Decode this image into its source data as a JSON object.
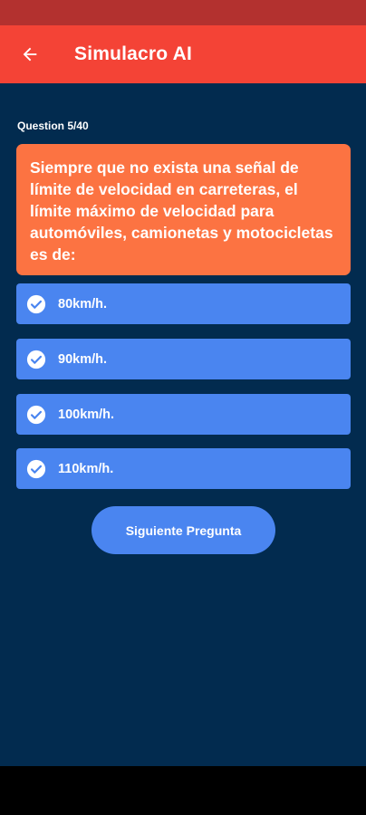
{
  "app_bar": {
    "title": "Simulacro AI",
    "back_icon": "arrow-left-icon"
  },
  "quiz": {
    "counter": "Question 5/40",
    "question": "Siempre que no exista una señal de límite de velocidad en carreteras, el límite máximo de velocidad para automóviles, camionetas y motocicletas es de:",
    "options": [
      {
        "label": "80km/h.",
        "icon": "check-circle-icon"
      },
      {
        "label": "90km/h.",
        "icon": "check-circle-icon"
      },
      {
        "label": "100km/h.",
        "icon": "check-circle-icon"
      },
      {
        "label": "110km/h.",
        "icon": "check-circle-icon"
      }
    ],
    "next_button": "Siguiente Pregunta"
  },
  "colors": {
    "status_bar": "#b3312f",
    "app_bar": "#f44336",
    "background": "#022b4f",
    "question_card": "#fc7342",
    "option": "#4a85f0",
    "button": "#4a85f0",
    "nav_bar": "#000000"
  }
}
